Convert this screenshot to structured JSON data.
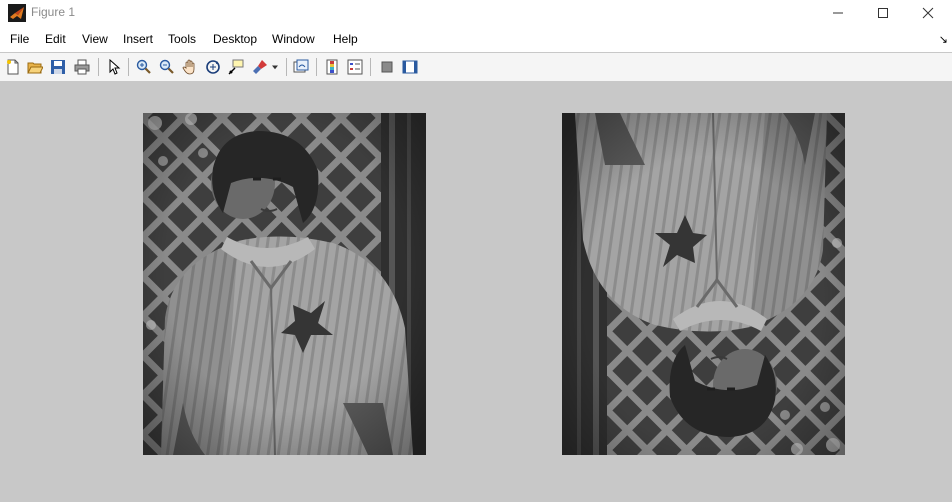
{
  "window": {
    "title": "Figure 1",
    "icon": "matlab-icon"
  },
  "window_controls": [
    "minimize-icon",
    "maximize-icon",
    "close-icon"
  ],
  "menu": [
    "File",
    "Edit",
    "View",
    "Insert",
    "Tools",
    "Desktop",
    "Window",
    "Help"
  ],
  "toolbar": {
    "buttons": [
      "new-figure-icon",
      "open-file-icon",
      "save-icon",
      "print-icon",
      "edit-plot-icon",
      "zoom-in-icon",
      "zoom-out-icon",
      "pan-icon",
      "rotate-3d-icon",
      "data-cursor-icon",
      "brush-icon",
      "link-plot-icon",
      "insert-colorbar-icon",
      "insert-legend-icon",
      "hide-plot-tools-icon",
      "show-plot-tools-icon"
    ]
  },
  "figure": {
    "background": "#c8c8c8",
    "axes": [
      {
        "content": "grayscale photograph of a child in a striped jacket in front of a lattice fence",
        "orientation": "upright"
      },
      {
        "content": "same photograph rotated 180 degrees",
        "orientation": "rotated 180"
      }
    ]
  }
}
